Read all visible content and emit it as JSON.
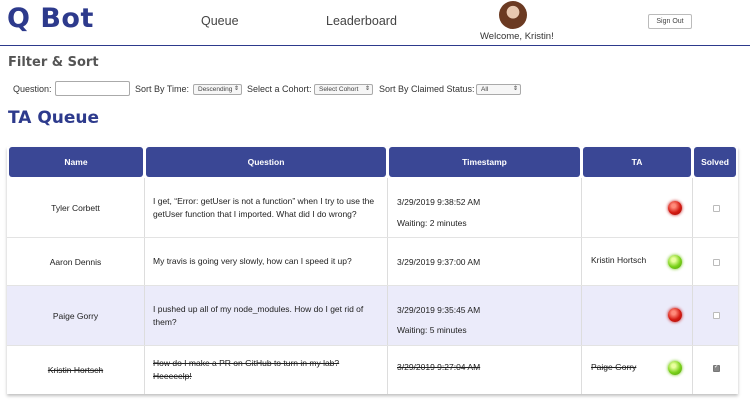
{
  "app": {
    "logo": "Q Bot",
    "nav": {
      "queue": "Queue",
      "leaderboard": "Leaderboard"
    },
    "welcome": "Welcome, Kristin!",
    "sign_out": "Sign Out"
  },
  "filter": {
    "heading": "Filter & Sort",
    "question_label": "Question:",
    "question_value": "",
    "sort_time_label": "Sort By Time:",
    "sort_time_value": "Descending",
    "cohort_label": "Select a Cohort:",
    "cohort_value": "Select Cohort",
    "claimed_label": "Sort By Claimed Status:",
    "claimed_value": "All"
  },
  "queue": {
    "heading": "TA Queue",
    "columns": [
      "Name",
      "Question",
      "Timestamp",
      "TA",
      "Solved"
    ],
    "rows": [
      {
        "name": "Tyler Corbett",
        "question": "I get, “Error: getUser is not a function” when I try to use the getUser function that I imported. What did I do wrong?",
        "timestamp": "3/29/2019 9:38:52 AM",
        "waiting": "Waiting: 2 minutes",
        "ta": "",
        "status": "red",
        "solved": false
      },
      {
        "name": "Aaron Dennis",
        "question": "My travis is going very slowly, how can I speed it up?",
        "timestamp": "3/29/2019 9:37:00 AM",
        "waiting": "",
        "ta": "Kristin Hortsch",
        "status": "green",
        "solved": false
      },
      {
        "name": "Paige Gorry",
        "question": "I pushed up all of my node_modules. How do I get rid of them?",
        "timestamp": "3/29/2019 9:35:45 AM",
        "waiting": "Waiting: 5 minutes",
        "ta": "",
        "status": "red",
        "solved": false
      },
      {
        "name": "Kristin Hortsch",
        "question": "How do I make a PR on GitHub to turn in my lab? Heeeeelp!",
        "timestamp": "3/29/2019 9:27:04 AM",
        "waiting": "",
        "ta": "Paige Gorry",
        "status": "green",
        "solved": true
      }
    ]
  },
  "colors": {
    "brand": "#2d3a8c",
    "header_cell": "#3a4795",
    "row_alt": "#ebebfa"
  },
  "icons": {
    "status_red": "red-status-light-icon",
    "status_green": "green-status-light-icon"
  }
}
